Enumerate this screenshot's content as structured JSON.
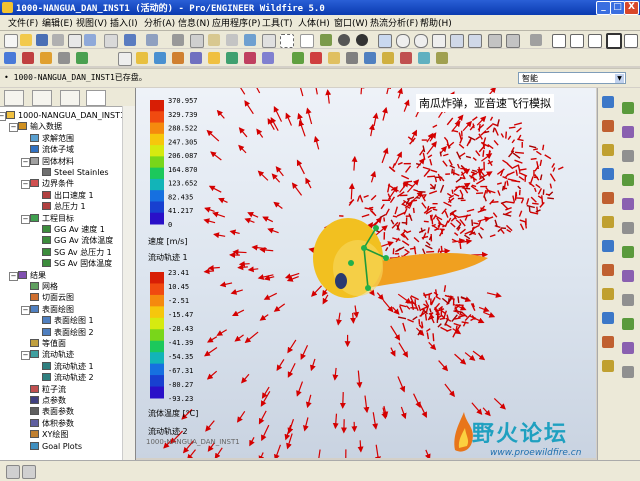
{
  "window": {
    "title": "1000-NANGUA_DAN_INST1 (活动的) - Pro/ENGINEER Wildfire 5.0",
    "minimize": "_",
    "maximize": "□",
    "close": "X"
  },
  "menu": [
    "文件(F)",
    "编辑(E)",
    "视图(V)",
    "插入(I)",
    "分析(A)",
    "信息(N)",
    "应用程序(P)",
    "工具(T)",
    "人体(H)",
    "窗口(W)",
    "热流分析(F)",
    "帮助(H)"
  ],
  "message": "• 1000-NANGUA_DAN_INST1已存盘。",
  "filter": {
    "value": "智能"
  },
  "tree": [
    {
      "label": "1000-NANGUA_DAN_INST1",
      "level": 0,
      "icon": "part-icon"
    },
    {
      "label": "输入数据",
      "level": 1,
      "icon": "folder-icon"
    },
    {
      "label": "求解范围",
      "level": 2,
      "icon": "domain-icon"
    },
    {
      "label": "流体子域",
      "level": 2,
      "icon": "fluid-icon"
    },
    {
      "label": "固体材料",
      "level": 2,
      "icon": "material-icon"
    },
    {
      "label": "Steel Stainles",
      "level": 3,
      "icon": "steel-icon"
    },
    {
      "label": "边界条件",
      "level": 2,
      "icon": "boundary-icon"
    },
    {
      "label": "出口速度 1",
      "level": 3,
      "icon": "bc-icon"
    },
    {
      "label": "总压力 1",
      "level": 3,
      "icon": "bc-icon"
    },
    {
      "label": "工程目标",
      "level": 2,
      "icon": "goal-folder-icon"
    },
    {
      "label": "GG Av 速度 1",
      "level": 3,
      "icon": "goal-icon"
    },
    {
      "label": "GG Av 流体温度",
      "level": 3,
      "icon": "goal-icon"
    },
    {
      "label": "SG Av 总压力 1",
      "level": 3,
      "icon": "goal-icon"
    },
    {
      "label": "SG Av 固体温度",
      "level": 3,
      "icon": "goal-icon"
    },
    {
      "label": "结果",
      "level": 1,
      "icon": "results-icon"
    },
    {
      "label": "网格",
      "level": 2,
      "icon": "mesh-icon"
    },
    {
      "label": "切面云图",
      "level": 2,
      "icon": "cutplot-icon"
    },
    {
      "label": "表面绘图",
      "level": 2,
      "icon": "surface-folder-icon"
    },
    {
      "label": "表面绘图 1",
      "level": 3,
      "icon": "surface-icon"
    },
    {
      "label": "表面绘图 2",
      "level": 3,
      "icon": "surface-icon"
    },
    {
      "label": "等值面",
      "level": 2,
      "icon": "isosurface-icon"
    },
    {
      "label": "流动轨迹",
      "level": 2,
      "icon": "trajectory-folder-icon"
    },
    {
      "label": "流动轨迹 1",
      "level": 3,
      "icon": "trajectory-icon"
    },
    {
      "label": "流动轨迹 2",
      "level": 3,
      "icon": "trajectory-icon"
    },
    {
      "label": "粒子流",
      "level": 2,
      "icon": "particle-icon"
    },
    {
      "label": "点参数",
      "level": 2,
      "icon": "point-icon"
    },
    {
      "label": "表面参数",
      "level": 2,
      "icon": "surfparam-icon"
    },
    {
      "label": "体积参数",
      "level": 2,
      "icon": "volparam-icon"
    },
    {
      "label": "XY绘图",
      "level": 2,
      "icon": "xyplot-icon"
    },
    {
      "label": "Goal Plots",
      "level": 2,
      "icon": "goalplot-icon"
    }
  ],
  "viewport": {
    "title": "南瓜炸弹，亚音速飞行模拟",
    "legend_velocity": {
      "values": [
        "370.957",
        "329.739",
        "288.522",
        "247.305",
        "206.087",
        "164.870",
        "123.652",
        "82.435",
        "41.217",
        "0"
      ],
      "title": "速度 [m/s]",
      "trace": "流动轨迹 1"
    },
    "legend_temperature": {
      "values": [
        "23.41",
        "10.45",
        "-2.51",
        "-15.47",
        "-28.43",
        "-41.39",
        "-54.35",
        "-67.31",
        "-80.27",
        "-93.23"
      ],
      "title": "流体温度 [°C]",
      "trace": "流动轨迹 2"
    },
    "corner_caption": "1000-NANGUA_DAN_INST1"
  },
  "watermark": {
    "text": "野火论坛",
    "url": "www.proewildfire.cn"
  },
  "colors": {
    "arrow": "#d40000",
    "bomb": "#f0b020",
    "accent": "#0a3ab0"
  }
}
